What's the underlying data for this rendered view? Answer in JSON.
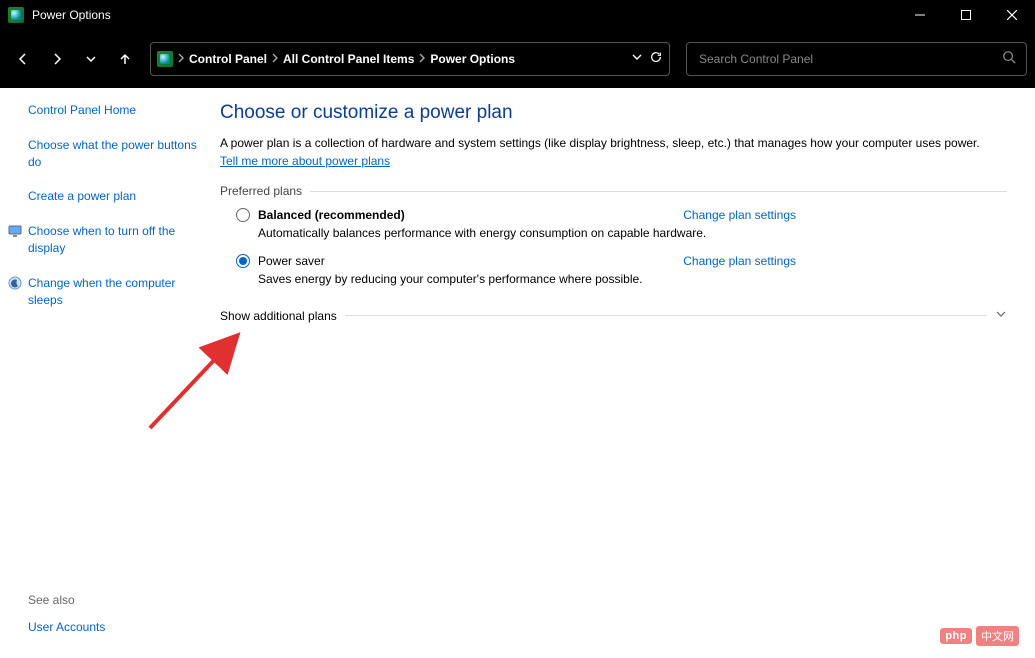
{
  "window": {
    "title": "Power Options"
  },
  "breadcrumb": {
    "root": "Control Panel",
    "mid": "All Control Panel Items",
    "leaf": "Power Options"
  },
  "search": {
    "placeholder": "Search Control Panel"
  },
  "sidebar": {
    "home": "Control Panel Home",
    "items": [
      "Choose what the power buttons do",
      "Create a power plan",
      "Choose when to turn off the display",
      "Change when the computer sleeps"
    ],
    "see_also_label": "See also",
    "see_also_link": "User Accounts"
  },
  "main": {
    "heading": "Choose or customize a power plan",
    "intro_a": "A power plan is a collection of hardware and system settings (like display brightness, sleep, etc.) that manages how your computer uses power. ",
    "intro_link": "Tell me more about power plans",
    "preferred_label": "Preferred plans",
    "plans": [
      {
        "name": "Balanced (recommended)",
        "desc": "Automatically balances performance with energy consumption on capable hardware.",
        "change": "Change plan settings",
        "selected": false
      },
      {
        "name": "Power saver",
        "desc": "Saves energy by reducing your computer's performance where possible.",
        "change": "Change plan settings",
        "selected": true
      }
    ],
    "show_additional": "Show additional plans"
  },
  "help_tooltip": "?",
  "watermark": {
    "logo": "php",
    "text": "中文网"
  }
}
